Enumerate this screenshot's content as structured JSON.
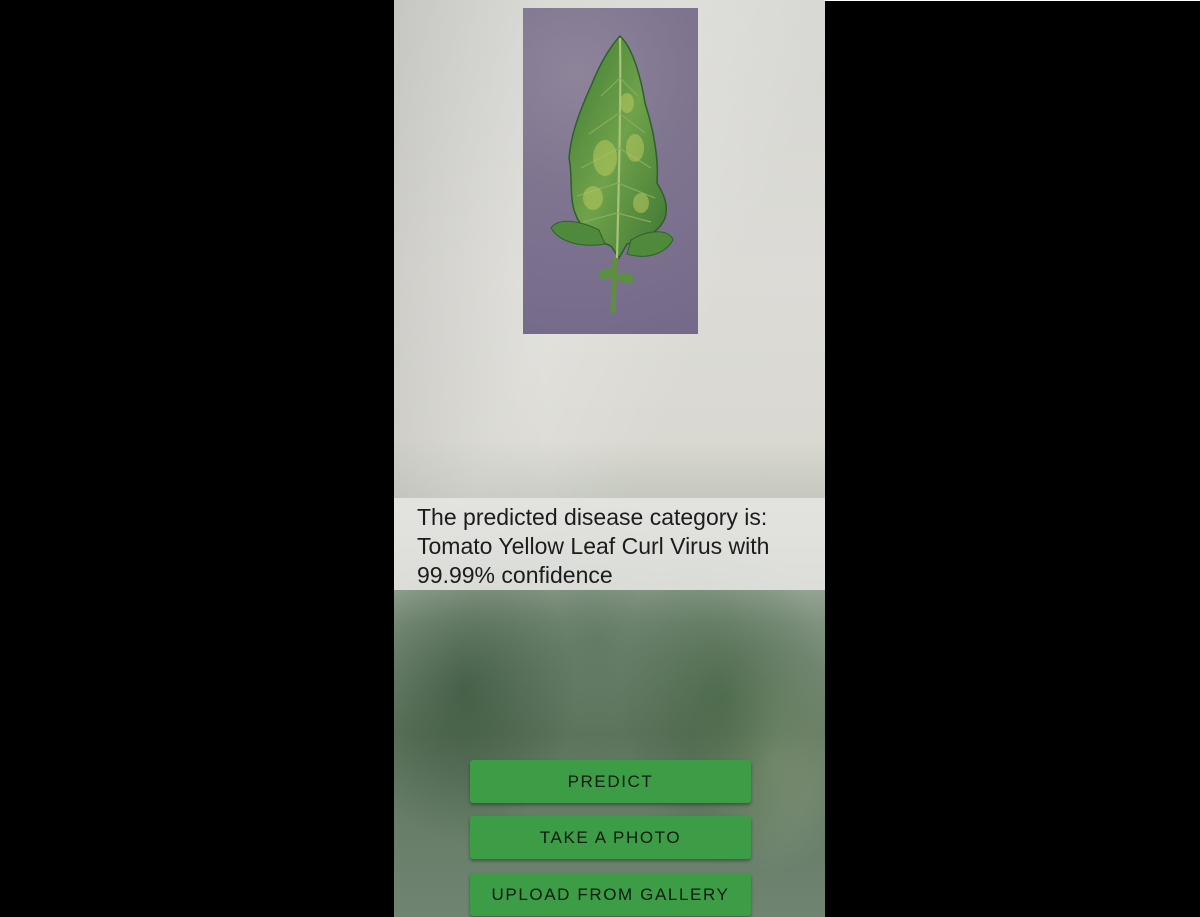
{
  "result": {
    "line1": "The predicted disease category is:",
    "line2": "Tomato Yellow Leaf Curl Virus with",
    "line3": "99.99% confidence"
  },
  "buttons": {
    "predict": "PREDICT",
    "take_photo": "TAKE A PHOTO",
    "upload_gallery": "UPLOAD FROM GALLERY"
  },
  "colors": {
    "button": "#3d9c46",
    "photo_background": "#7f7590",
    "leaf": "#4f8a3c"
  },
  "image": {
    "subject": "tomato-leaf-icon"
  }
}
